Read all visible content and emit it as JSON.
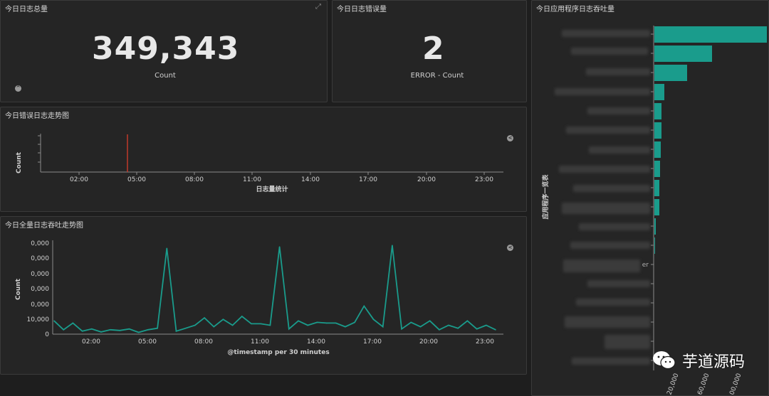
{
  "panels": {
    "total_logs": {
      "title": "今日日志总量",
      "value": "349,343",
      "label": "Count"
    },
    "error_logs": {
      "title": "今日日志错误量",
      "value": "2",
      "label": "ERROR - Count"
    },
    "error_trend": {
      "title": "今日错误日志走势图",
      "y_label": "Count",
      "x_label": "日志量统计",
      "x_ticks": [
        "02:00",
        "05:00",
        "08:00",
        "11:00",
        "14:00",
        "17:00",
        "20:00",
        "23:00"
      ]
    },
    "throughput_trend": {
      "title": "今日全量日志吞吐走势图",
      "y_label": "Count",
      "x_label": "@timestamp per 30 minutes",
      "y_ticks": [
        "0,000",
        "0,000",
        "0,000",
        "0,000",
        "0,000",
        "10,000",
        "0"
      ],
      "x_ticks": [
        "02:00",
        "05:00",
        "08:00",
        "11:00",
        "14:00",
        "17:00",
        "20:00",
        "23:00"
      ]
    },
    "app_throughput": {
      "title": "今日应用程序日志吞吐量",
      "y_label": "应用程序一览表",
      "x_ticks": [
        "20,000",
        "60,000",
        "00,000"
      ],
      "partial_label": "er"
    }
  },
  "watermark": {
    "text": "芋道源码"
  },
  "colors": {
    "teal": "#1a9c8c",
    "error_line": "#c0392b",
    "panel_bg": "#252525",
    "page_bg": "#1e1e1e"
  },
  "icons": {
    "expand": "expand-icon",
    "collapse": "chevron-up-icon",
    "legend_toggle": "chevron-left-icon",
    "wechat_logo": "wechat-icon"
  },
  "chart_data": [
    {
      "type": "line",
      "x": [
        "00:00",
        "00:30",
        "01:00",
        "01:30",
        "02:00",
        "02:30",
        "03:00",
        "03:30",
        "04:00",
        "04:30",
        "05:00",
        "05:30",
        "06:00",
        "06:30",
        "07:00",
        "07:30",
        "08:00",
        "08:30",
        "09:00",
        "09:30",
        "10:00",
        "10:30",
        "11:00",
        "11:30",
        "12:00",
        "12:30",
        "13:00",
        "13:30",
        "14:00",
        "14:30",
        "15:00",
        "15:30",
        "16:00",
        "16:30",
        "17:00",
        "17:30",
        "18:00",
        "18:30",
        "19:00",
        "19:30",
        "20:00",
        "20:30",
        "21:00",
        "21:30",
        "22:00",
        "22:30",
        "23:00",
        "23:30"
      ],
      "series": [
        {
          "values": [
            9000,
            3000,
            7500,
            2000,
            3500,
            1500,
            3000,
            2500,
            3500,
            1200,
            3000,
            4000,
            58000,
            2000,
            4000,
            6000,
            11000,
            5000,
            10000,
            6000,
            12000,
            7000,
            7000,
            6000,
            59000,
            3500,
            9000,
            6000,
            8000,
            7500,
            7500,
            5000,
            8000,
            19000,
            10000,
            5000,
            60000,
            3500,
            8000,
            5000,
            9000,
            3000,
            6000,
            4000,
            9000,
            3500,
            6000,
            3000
          ]
        }
      ],
      "xlabel": "@timestamp per 30 minutes",
      "ylabel": "Count"
    }
  ]
}
